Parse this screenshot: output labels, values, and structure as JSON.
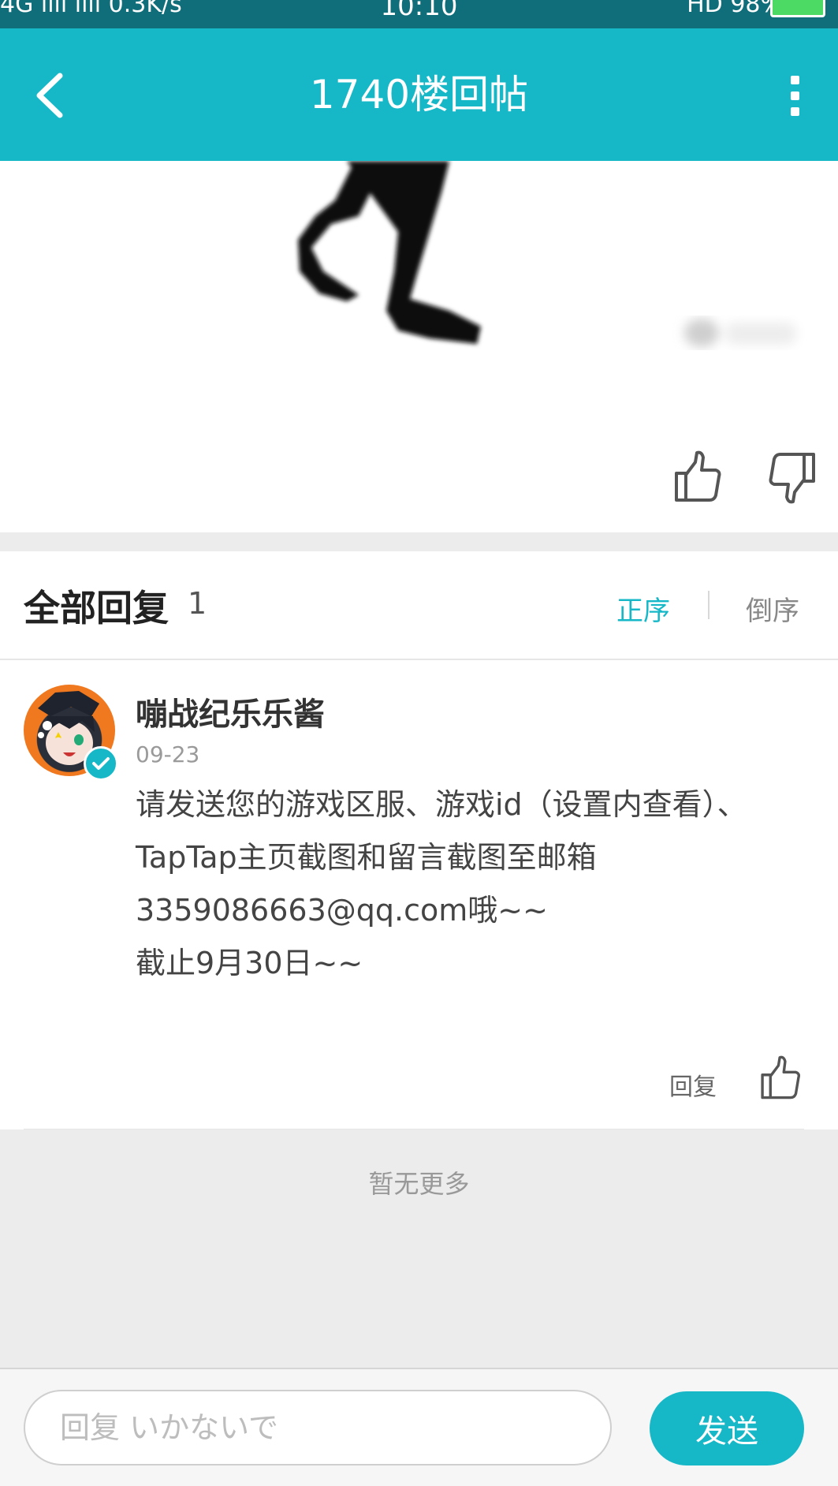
{
  "status_bar": {
    "left": "4G ııll  ıııl  0.3K/s",
    "time": "10:10",
    "right": "HD  98%"
  },
  "header": {
    "title": "1740楼回帖",
    "back_icon": "back-arrow-icon",
    "more_icon": "more-vertical-icon"
  },
  "colors": {
    "primary": "#16b8c8",
    "status_bar": "#106e7a",
    "gray_bg": "#ececec"
  },
  "post_actions": {
    "like_icon": "thumbs-up-icon",
    "dislike_icon": "thumbs-down-icon"
  },
  "replies": {
    "title": "全部回复",
    "count": "1",
    "sort_asc": "正序",
    "sort_desc": "倒序",
    "items": [
      {
        "user": "嘣战纪乐乐酱",
        "date": "09-23",
        "text": "请发送您的游戏区服、游戏id（设置内查看）、TapTap主页截图和留言截图至邮箱3359086663@qq.com哦~~\n截止9月30日~~",
        "reply_label": "回复"
      }
    ],
    "no_more": "暂无更多"
  },
  "composer": {
    "placeholder": "回复 いかないで",
    "value": "",
    "send_label": "发送"
  }
}
